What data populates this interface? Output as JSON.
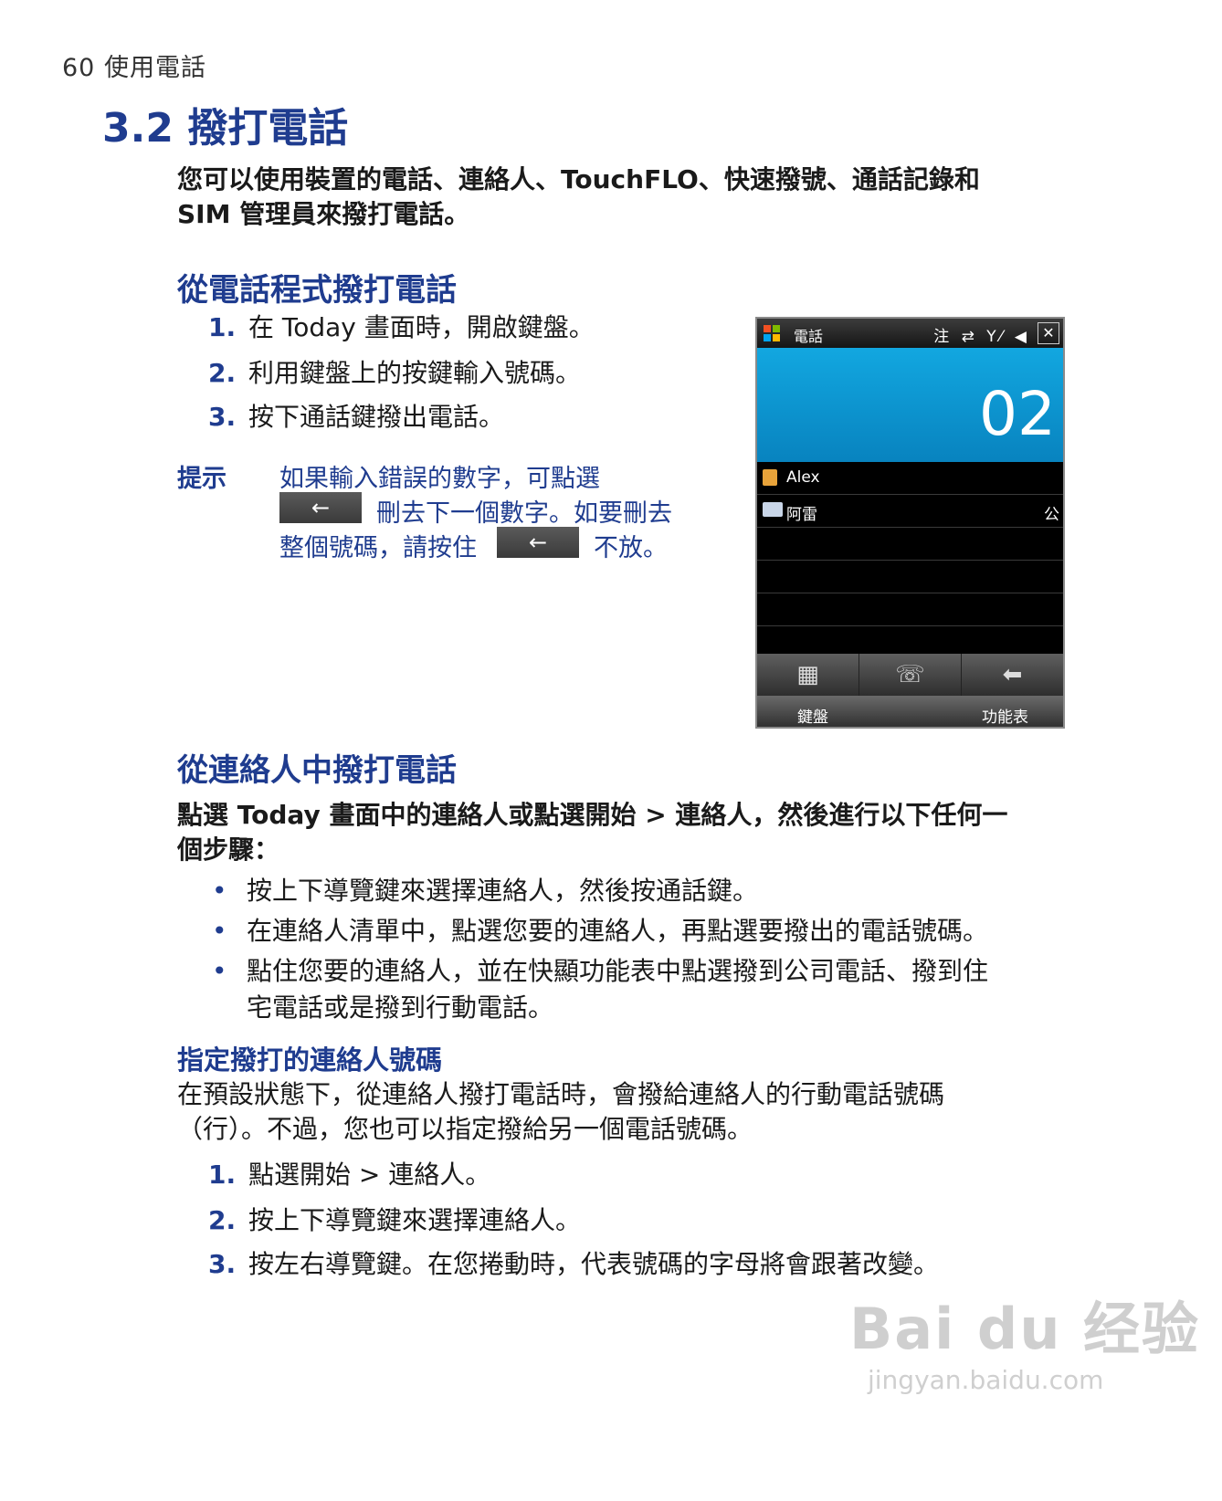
{
  "header": {
    "page_label": "60  使用電話"
  },
  "section": {
    "title": "3.2 撥打電話"
  },
  "intro": {
    "line1": "您可以使用裝置的電話、連絡人、TouchFLO、快速撥號、通話記錄和",
    "line2": "SIM 管理員來撥打電話。"
  },
  "phone_section": {
    "heading": "從電話程式撥打電話",
    "steps": [
      {
        "num": "1.",
        "text": "在 Today 畫面時，開啟鍵盤。"
      },
      {
        "num": "2.",
        "text": "利用鍵盤上的按鍵輸入號碼。"
      },
      {
        "num": "3.",
        "text": "按下通話鍵撥出電話。"
      }
    ],
    "tip_label": "提示",
    "tip_line1": "如果輸入錯誤的數字，可點選",
    "tip_line2b": "刪去下一個數字。如要刪去",
    "tip_line3a": "整個號碼，請按住",
    "tip_line3b": "不放。",
    "back_key_glyph": "←"
  },
  "phone_screen": {
    "title": "電話",
    "status_icons": "注 ⇄ Y⁄ ◀",
    "close": "✕",
    "display_digits": "02",
    "list": [
      {
        "name": "Alex",
        "tag": ""
      },
      {
        "name": "阿雷",
        "tag": "公"
      }
    ],
    "toolbar_icons": [
      "keypad-icon",
      "speaker-phone-icon",
      "backspace-icon"
    ],
    "toolbar_glyphs": [
      "▦",
      "☏",
      "⬅"
    ],
    "soft_left": "鍵盤",
    "soft_right": "功能表"
  },
  "contacts_section": {
    "heading": "從連絡人中撥打電話",
    "para_line1": "點選 Today 畫面中的連絡人或點選開始 > 連絡人，然後進行以下任何一",
    "para_line2": "個步驟：",
    "bullets": [
      {
        "text": "按上下導覽鍵來選擇連絡人，然後按通話鍵。"
      },
      {
        "text": "在連絡人清單中，點選您要的連絡人，再點選要撥出的電話號碼。"
      },
      {
        "text": "點住您要的連絡人，並在快顯功能表中點選撥到公司電話、撥到住"
      },
      {
        "text": "宅電話或是撥到行動電話。"
      }
    ],
    "bullet_glyph": "•"
  },
  "assign_section": {
    "heading": "指定撥打的連絡人號碼",
    "para_line1": "在預設狀態下，從連絡人撥打電話時，會撥給連絡人的行動電話號碼",
    "para_line2": "（行）。不過，您也可以指定撥給另一個電話號碼。",
    "steps": [
      {
        "num": "1.",
        "text": "點選開始 > 連絡人。"
      },
      {
        "num": "2.",
        "text": "按上下導覽鍵來選擇連絡人。"
      },
      {
        "num": "3.",
        "text": "按左右導覽鍵。在您捲動時，代表號碼的字母將會跟著改變。"
      }
    ]
  },
  "watermark": {
    "logo": "Bai du 经验",
    "url": "jingyan.baidu.com"
  }
}
